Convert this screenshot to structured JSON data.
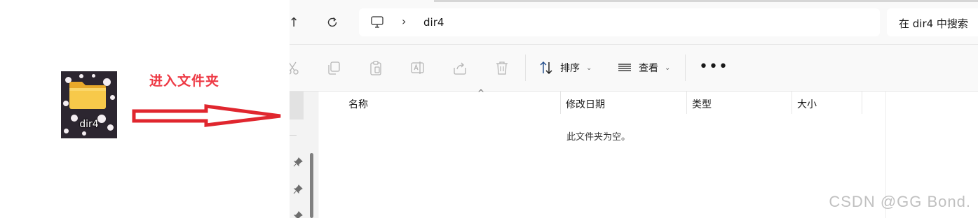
{
  "desktop": {
    "folder_label": "dir4",
    "annotation": "进入文件夹"
  },
  "explorer": {
    "address": {
      "path": "dir4"
    },
    "search": {
      "placeholder": "在 dir4 中搜索"
    },
    "toolbar": {
      "sort_label": "排序",
      "view_label": "查看",
      "more_label": "•••"
    },
    "columns": [
      "名称",
      "修改日期",
      "类型",
      "大小"
    ],
    "empty_message": "此文件夹为空。"
  },
  "watermark": "CSDN @GG Bond."
}
